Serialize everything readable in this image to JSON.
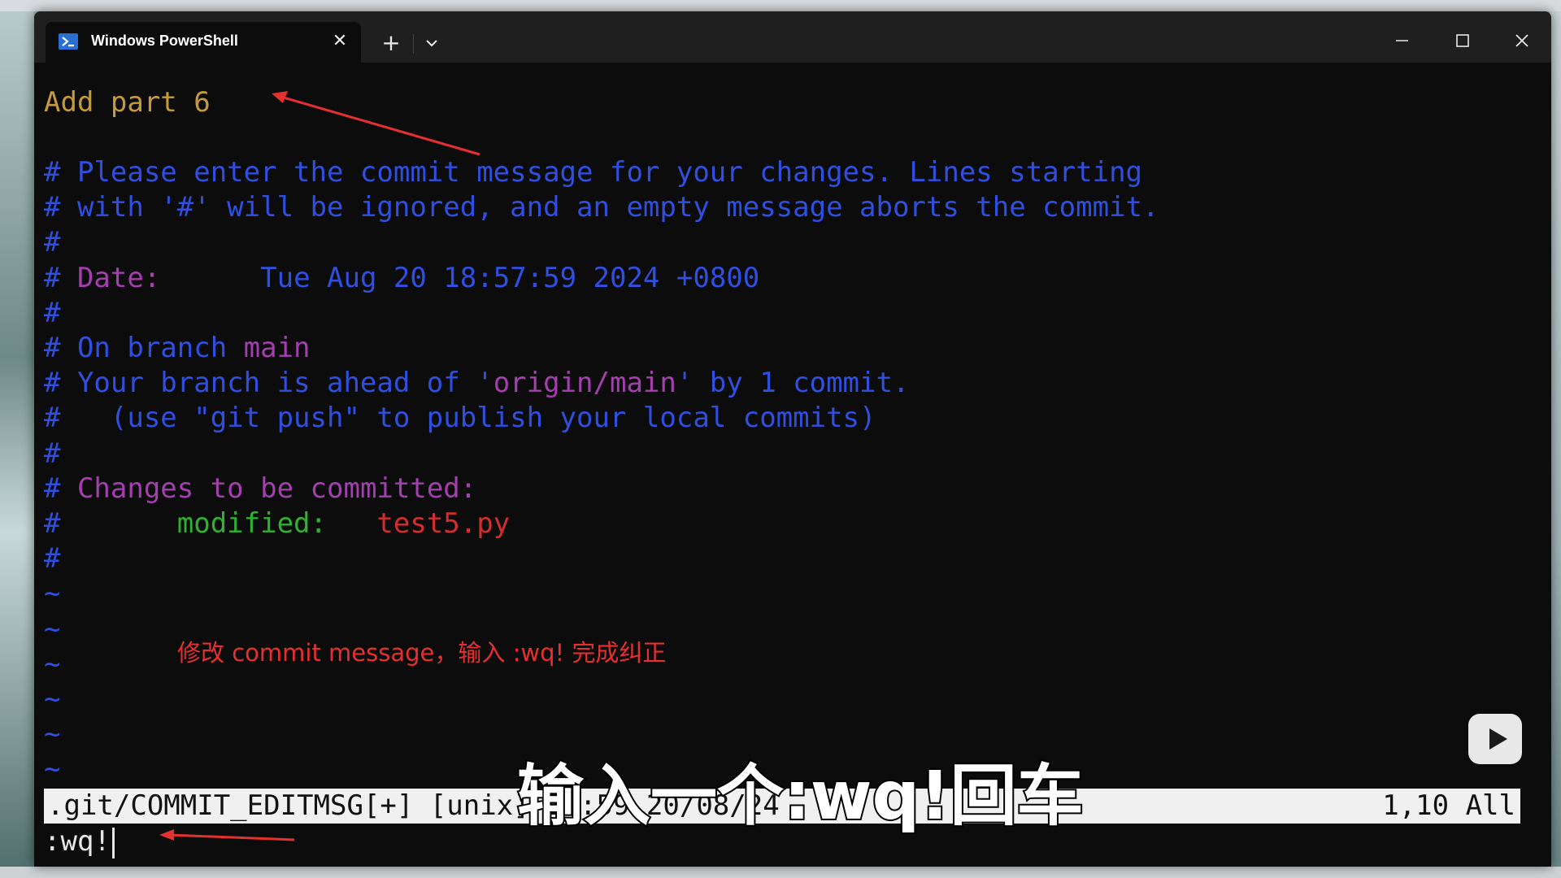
{
  "window": {
    "tab_title": "Windows PowerShell",
    "tab_close": "✕",
    "new_tab": "+"
  },
  "editor": {
    "commit_title": "Add part 6",
    "lines": [
      {
        "parts": [
          {
            "t": "# Please enter the commit message for your changes. Lines starting",
            "c": "blue"
          }
        ]
      },
      {
        "parts": [
          {
            "t": "# with '#' will be ignored, and an empty message aborts the commit.",
            "c": "blue"
          }
        ]
      },
      {
        "parts": [
          {
            "t": "#",
            "c": "blue"
          }
        ]
      },
      {
        "parts": [
          {
            "t": "# ",
            "c": "blue"
          },
          {
            "t": "Date:",
            "c": "purple"
          },
          {
            "t": "      Tue Aug 20 18:57:59 2024 +0800",
            "c": "blue"
          }
        ]
      },
      {
        "parts": [
          {
            "t": "#",
            "c": "blue"
          }
        ]
      },
      {
        "parts": [
          {
            "t": "# On branch ",
            "c": "blue"
          },
          {
            "t": "main",
            "c": "purple"
          }
        ]
      },
      {
        "parts": [
          {
            "t": "# Your branch is ahead of '",
            "c": "blue"
          },
          {
            "t": "origin/main",
            "c": "purple"
          },
          {
            "t": "' by 1 commit.",
            "c": "blue"
          }
        ]
      },
      {
        "parts": [
          {
            "t": "#   (use \"git push\" to publish your local commits)",
            "c": "blue"
          }
        ]
      },
      {
        "parts": [
          {
            "t": "#",
            "c": "blue"
          }
        ]
      },
      {
        "parts": [
          {
            "t": "# ",
            "c": "blue"
          },
          {
            "t": "Changes to be committed:",
            "c": "purple"
          }
        ]
      },
      {
        "parts": [
          {
            "t": "#       ",
            "c": "blue"
          },
          {
            "t": "modified:",
            "c": "green"
          },
          {
            "t": "   ",
            "c": "blue"
          },
          {
            "t": "test5.py",
            "c": "red"
          }
        ]
      },
      {
        "parts": [
          {
            "t": "#",
            "c": "blue"
          }
        ]
      },
      {
        "parts": [
          {
            "t": "~",
            "c": "tilde"
          }
        ]
      },
      {
        "parts": [
          {
            "t": "~",
            "c": "tilde"
          }
        ]
      },
      {
        "parts": [
          {
            "t": "~",
            "c": "tilde"
          }
        ]
      },
      {
        "parts": [
          {
            "t": "~",
            "c": "tilde"
          }
        ]
      },
      {
        "parts": [
          {
            "t": "~",
            "c": "tilde"
          }
        ]
      },
      {
        "parts": [
          {
            "t": "~",
            "c": "tilde"
          }
        ]
      }
    ],
    "status_left": ".git/COMMIT_EDITMSG[+] [unix] 18:59 20/08/24",
    "status_right": "1,10 All",
    "command": ":wq!"
  },
  "overlay": {
    "annotation": "修改 commit message，输入 :wq! 完成纠正",
    "subtitle": "输入一个:wq!回车"
  },
  "colors": {
    "orange": "#c49a3a",
    "blue": "#2f4fe0",
    "purple": "#a43fb0",
    "green": "#2fb22f",
    "red": "#d22e2e",
    "annotation": "#e53030"
  }
}
